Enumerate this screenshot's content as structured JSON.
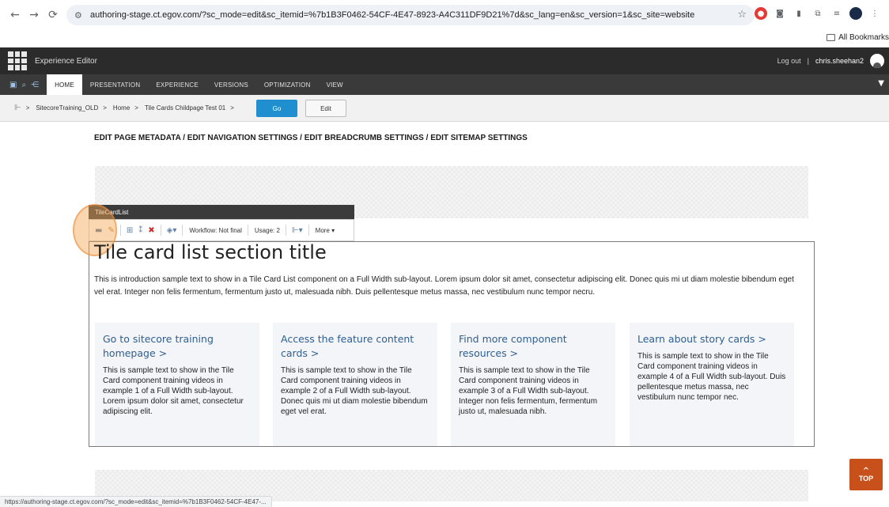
{
  "browser": {
    "url": "authoring-stage.ct.egov.com/?sc_mode=edit&sc_itemid=%7b1B3F0462-54CF-4E47-8923-A4C311DF9D21%7d&sc_lang=en&sc_version=1&sc_site=website",
    "bookmarks_label": "All Bookmarks",
    "status_url": "https://authoring-stage.ct.egov.com/?sc_mode=edit&sc_itemid=%7b1B3F0462-54CF-4E47-..."
  },
  "editor": {
    "title": "Experience Editor",
    "logout": "Log out",
    "separator": "|",
    "user": "chris.sheehan2"
  },
  "ribbon": {
    "tabs": [
      "HOME",
      "PRESENTATION",
      "EXPERIENCE",
      "VERSIONS",
      "OPTIMIZATION",
      "VIEW"
    ]
  },
  "breadcrumb": {
    "items": [
      "SitecoreTraining_OLD",
      "Home",
      "Tile Cards Childpage Test 01"
    ],
    "sep": ">",
    "go_label": "Go",
    "edit_label": "Edit"
  },
  "page": {
    "meta_links": "EDIT PAGE METADATA / EDIT NAVIGATION SETTINGS / EDIT BREADCRUMB SETTINGS / EDIT SITEMAP SETTINGS"
  },
  "component_toolbar": {
    "name": "TileCardList",
    "workflow": "Workflow: Not final",
    "usage": "Usage: 2",
    "more": "More"
  },
  "section": {
    "title": "Tile card list section title",
    "intro": "This is introduction sample text to show in a Tile Card List component on a Full Width sub-layout. Lorem ipsum dolor sit amet, consectetur adipiscing elit. Donec quis mi ut diam molestie bibendum eget vel erat. Integer non felis fermentum, fermentum justo ut, malesuada nibh. Duis pellentesque metus massa, nec vestibulum nunc tempor necru."
  },
  "cards": [
    {
      "title": "Go to sitecore training homepage >",
      "text": "This is sample text to show in the Tile Card component training videos in example 1 of a Full Width sub-layout. Lorem ipsum dolor sit amet, consectetur adipiscing elit."
    },
    {
      "title": "Access the feature content cards >",
      "text": "This is sample text to show in the Tile Card component training videos in example 2 of a Full Width sub-layout. Donec quis mi ut diam molestie bibendum eget vel erat."
    },
    {
      "title": "Find more component resources >",
      "text": "This is sample text to show in the Tile Card component training videos in example 3 of a Full Width sub-layout. Integer non felis fermentum, fermentum justo ut, malesuada nibh."
    },
    {
      "title": "Learn about story cards >",
      "text": "This is sample text to show in the Tile Card component training videos in example 4 of a Full Width sub-layout. Duis pellentesque metus massa, nec vestibulum nunc tempor nec."
    }
  ],
  "top_button": {
    "label": "TOP"
  },
  "icons": {
    "back": "arrow-left-icon",
    "forward": "arrow-right-icon",
    "reload": "reload-icon",
    "bookmark_star": "star-icon",
    "save": "save-icon",
    "search": "search-icon",
    "share": "share-icon",
    "edit": "pencil-icon",
    "delete": "delete-icon"
  },
  "colors": {
    "go_button": "#1f8fcf",
    "top_button": "#c8511b",
    "card_title": "#2f5f91",
    "editor_bar": "#2b2b2b"
  }
}
